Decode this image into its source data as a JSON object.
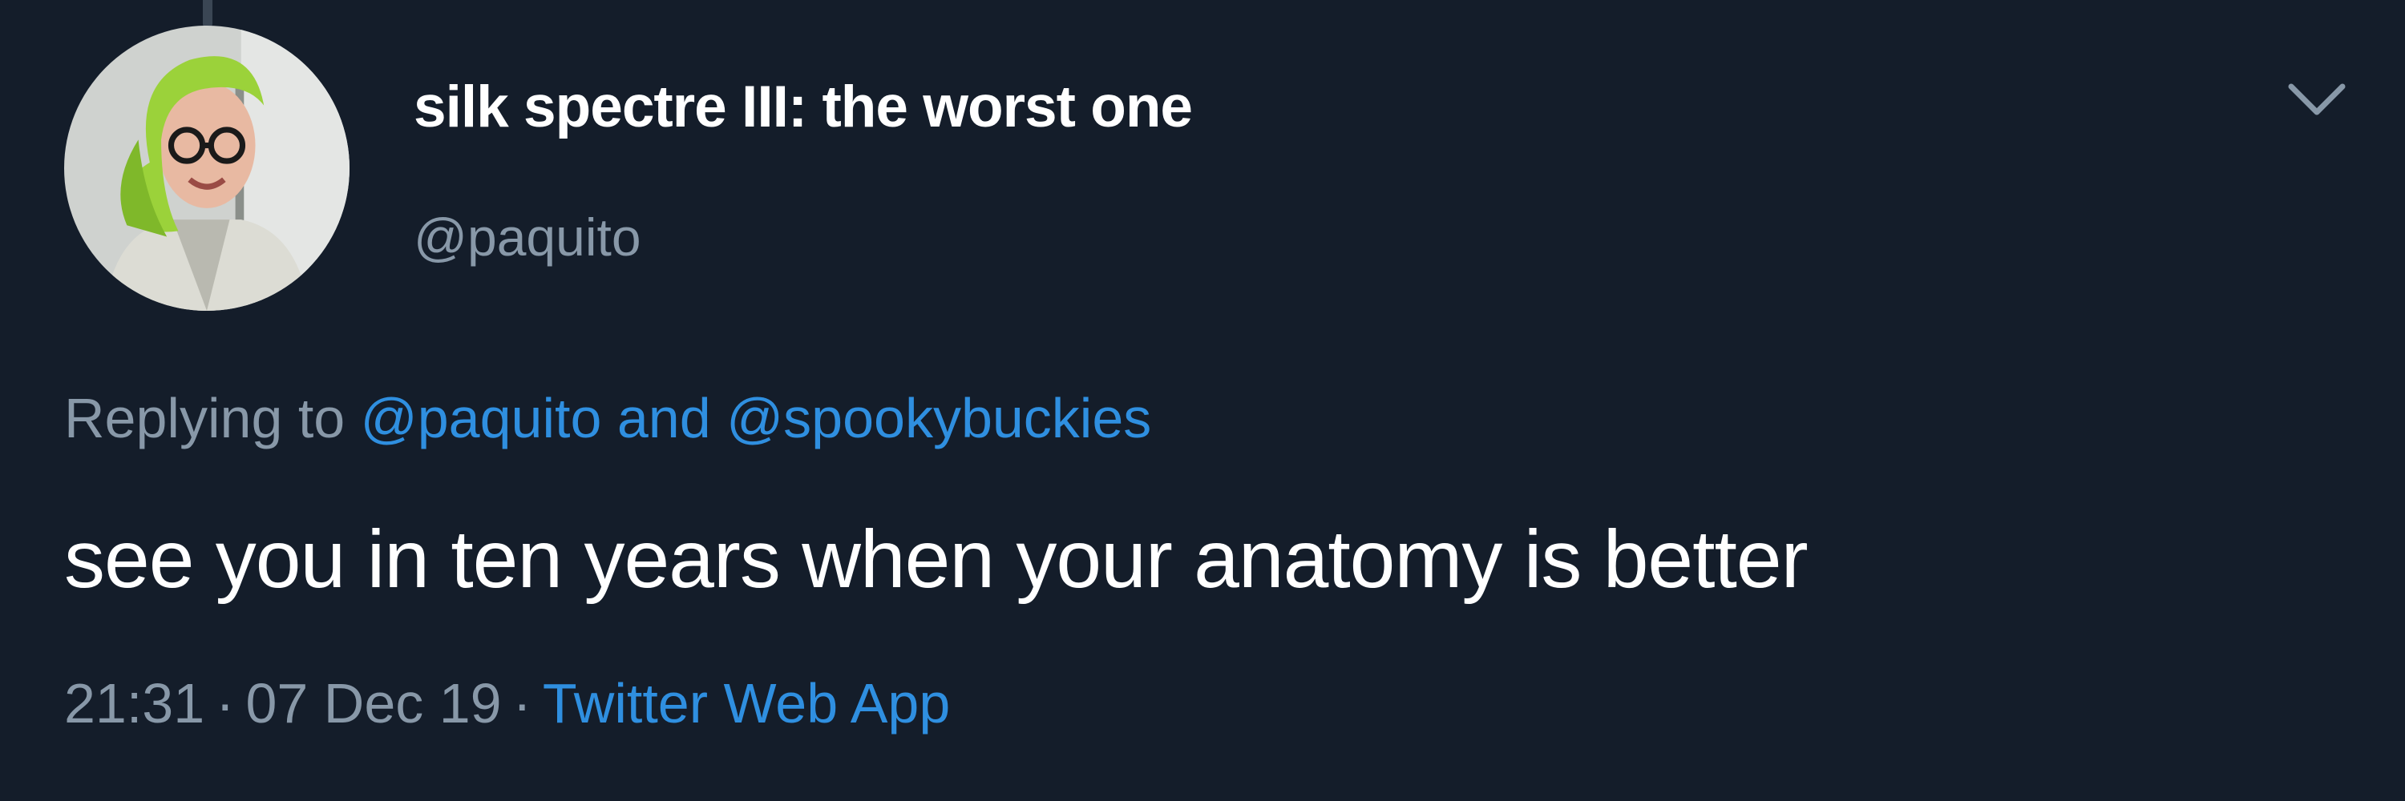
{
  "tweet": {
    "display_name": "silk spectre III: the worst one",
    "handle": "@paquito",
    "replying": {
      "prefix": "Replying to",
      "mention_1": "@paquito",
      "conjunction": "and",
      "mention_2": "@spookybuckies"
    },
    "text": "see you in ten years when your anatomy is better",
    "meta": {
      "time": "21:31",
      "separator": "·",
      "date": "07 Dec 19",
      "app": "Twitter Web App"
    },
    "avatar_icon": "user-avatar-photo",
    "menu_icon": "chevron-down-icon"
  },
  "colors": {
    "background": "#141d2a",
    "primary_text": "#ffffff",
    "secondary_text": "#8898a8",
    "accent": "#2f8fe0"
  }
}
